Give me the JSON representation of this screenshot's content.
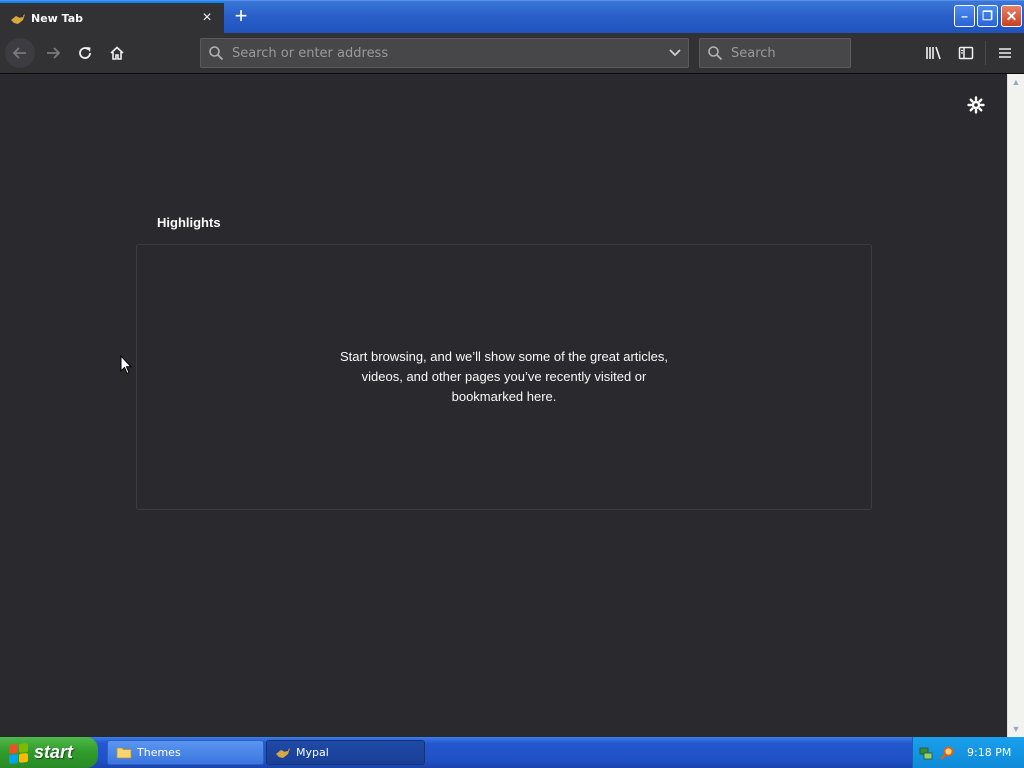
{
  "tab": {
    "title": "New Tab",
    "close_glyph": "×",
    "icon": "mypal-icon"
  },
  "newtab": {
    "glyph": "+"
  },
  "window": {
    "minimize": "–",
    "maximize": "❐",
    "close": "✕"
  },
  "nav": {
    "back_icon": "arrow-left-icon",
    "forward_icon": "arrow-right-icon",
    "reload_icon": "reload-icon",
    "home_icon": "home-icon"
  },
  "urlbar": {
    "placeholder": "Search or enter address",
    "value": ""
  },
  "searchbar": {
    "placeholder": "Search",
    "value": ""
  },
  "toolbar_right": {
    "library_icon": "library-icon",
    "sidebar_icon": "sidebar-icon",
    "menu_icon": "hamburger-menu-icon"
  },
  "content": {
    "highlights_title": "Highlights",
    "empty_message": "Start browsing, and we’ll show some of the great articles, videos, and other pages you’ve recently visited or bookmarked here."
  },
  "taskbar": {
    "start_label": "start",
    "tasks": [
      {
        "label": "Themes",
        "icon": "folder-icon"
      },
      {
        "label": "Mypal",
        "icon": "mypal-icon"
      }
    ],
    "clock": "9:18 PM"
  },
  "colors": {
    "accent": "#0a84ff",
    "content_bg": "#2a2a2e",
    "toolbar_bg": "#323234",
    "text": "#f9f9fa"
  }
}
